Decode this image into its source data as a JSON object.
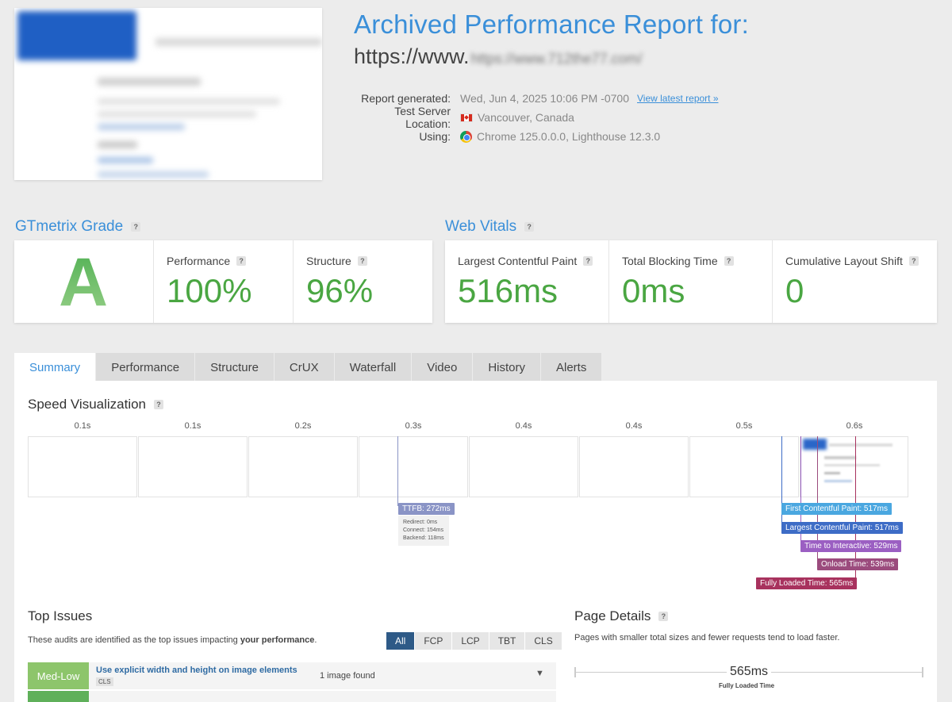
{
  "report": {
    "title": "Archived Performance Report for:",
    "url_prefix": "https://www.",
    "url_blurred": "https://www.712the77.com/",
    "meta": [
      {
        "label": "Report generated:",
        "value": "Wed, Jun 4, 2025 10:06 PM -0700",
        "link": "View latest report »"
      },
      {
        "label": "Test Server Location:",
        "value": "Vancouver, Canada"
      },
      {
        "label": "Using:",
        "value": "Chrome 125.0.0.0, Lighthouse 12.3.0"
      }
    ]
  },
  "grade": {
    "title": "GTmetrix Grade",
    "letter": "A",
    "performance_label": "Performance",
    "performance_value": "100%",
    "structure_label": "Structure",
    "structure_value": "96%"
  },
  "vitals": {
    "title": "Web Vitals",
    "lcp_label": "Largest Contentful Paint",
    "lcp_value": "516ms",
    "tbt_label": "Total Blocking Time",
    "tbt_value": "0ms",
    "cls_label": "Cumulative Layout Shift",
    "cls_value": "0"
  },
  "tabs": [
    "Summary",
    "Performance",
    "Structure",
    "CrUX",
    "Waterfall",
    "Video",
    "History",
    "Alerts"
  ],
  "speed": {
    "title": "Speed Visualization",
    "ticks": [
      "0.1s",
      "0.1s",
      "0.2s",
      "0.3s",
      "0.4s",
      "0.4s",
      "0.5s",
      "0.6s"
    ],
    "ttfb": {
      "label": "TTFB: 272ms",
      "redirect": "Redirect: 0ms",
      "connect": "Connect: 154ms",
      "backend": "Backend: 118ms"
    },
    "markers": {
      "fcp": "First Contentful Paint: 517ms",
      "lcp": "Largest Contentful Paint: 517ms",
      "tti": "Time to Interactive: 529ms",
      "onload": "Onload Time: 539ms",
      "fully": "Fully Loaded Time: 565ms"
    },
    "colors": {
      "ttfb": "#8a94c6",
      "fcp": "#4aa7e0",
      "lcp": "#3d6cc6",
      "tti": "#9b5fc2",
      "onload": "#9b4b7d",
      "fully": "#a8325e"
    }
  },
  "issues": {
    "title": "Top Issues",
    "desc_prefix": "These audits are identified as the top issues impacting ",
    "desc_bold": "your performance",
    "desc_suffix": ".",
    "filters": [
      "All",
      "FCP",
      "LCP",
      "TBT",
      "CLS"
    ],
    "row": {
      "severity": "Med-Low",
      "title": "Use explicit width and height on image elements",
      "tag": "CLS",
      "found": "1 image found"
    }
  },
  "page_details": {
    "title": "Page Details",
    "desc": "Pages with smaller total sizes and fewer requests tend to load faster.",
    "value": "565ms",
    "label": "Fully Loaded Time"
  }
}
